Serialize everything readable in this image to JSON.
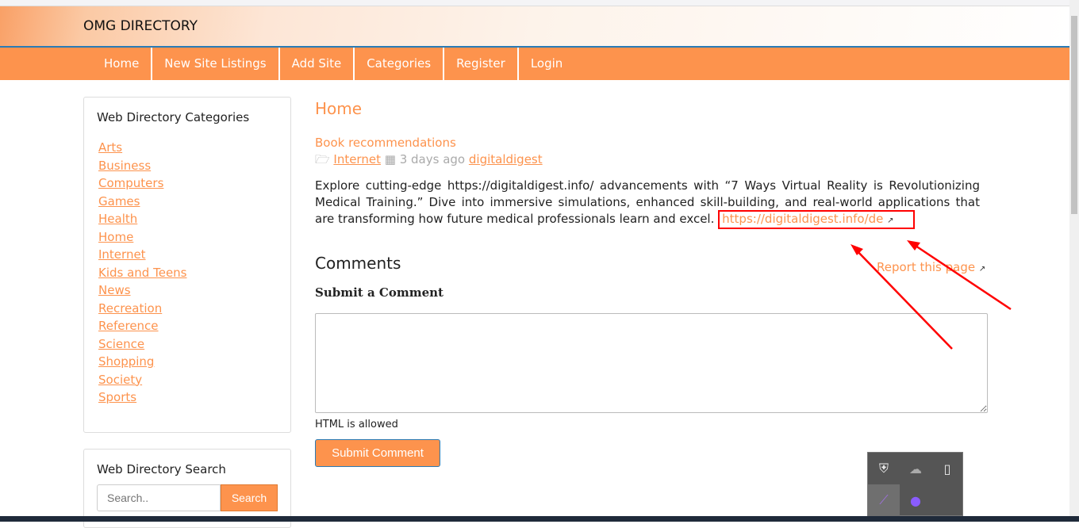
{
  "site_title": "OMG DIRECTORY",
  "nav": [
    "Home",
    "New Site Listings",
    "Add Site",
    "Categories",
    "Register",
    "Login"
  ],
  "sidebar": {
    "categories_title": "Web Directory Categories",
    "categories": [
      "Arts",
      "Business",
      "Computers",
      "Games",
      "Health",
      "Home",
      "Internet",
      "Kids and Teens",
      "News",
      "Recreation",
      "Reference",
      "Science",
      "Shopping",
      "Society",
      "Sports"
    ],
    "search_title": "Web Directory Search",
    "search_placeholder": "Search..",
    "search_button": "Search"
  },
  "main": {
    "heading": "Home",
    "listing_title": "Book recommendations",
    "category": "Internet",
    "date": "3 days ago",
    "author": "digitaldigest",
    "description": "Explore cutting-edge https://digitaldigest.info/ advancements with “7 Ways Virtual Reality is Revolutionizing Medical Training.” Dive into immersive simulations, enhanced skill-building, and real-world applications that are transforming how future medical professionals learn and excel.",
    "link": "https://digitaldigest.info/de",
    "report": "Report this page",
    "comments_heading": "Comments",
    "submit_heading": "Submit a Comment",
    "html_note": "HTML is allowed",
    "submit_button": "Submit Comment"
  },
  "colors": {
    "accent": "#fd934d",
    "annotation": "#ff0000"
  }
}
